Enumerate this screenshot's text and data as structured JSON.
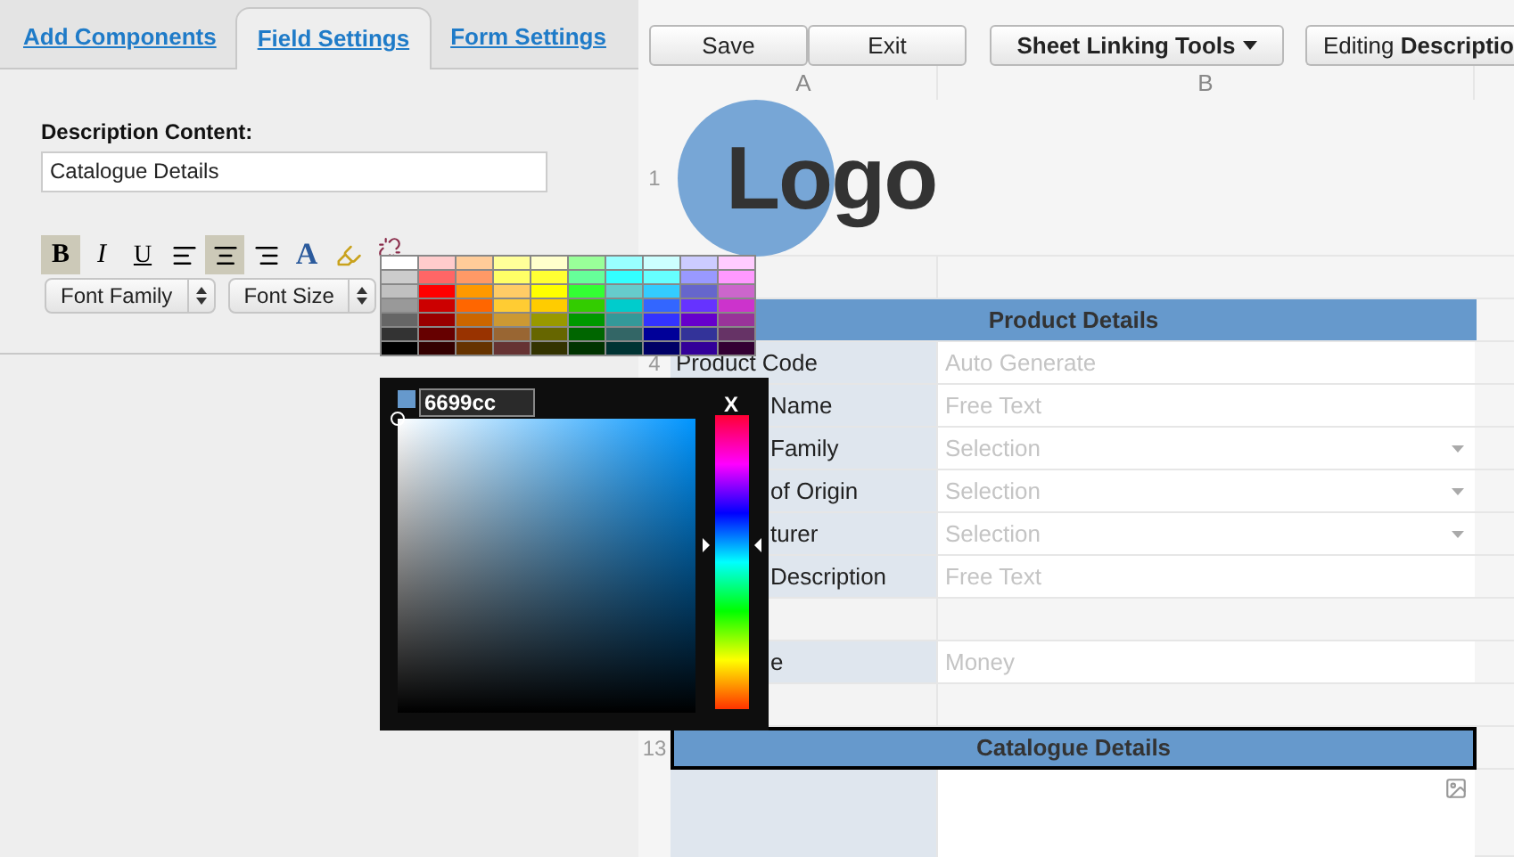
{
  "tabs": [
    {
      "label": "Add Components",
      "selected": false
    },
    {
      "label": "Field Settings",
      "selected": true
    },
    {
      "label": "Form Settings",
      "selected": false
    }
  ],
  "field": {
    "label": "Description Content:",
    "value": "Catalogue Details"
  },
  "format_buttons": [
    {
      "kind": "bold",
      "label": "B",
      "pressed": true
    },
    {
      "kind": "italic",
      "label": "I",
      "pressed": false
    },
    {
      "kind": "underline",
      "label": "U",
      "pressed": false
    },
    {
      "kind": "align-left",
      "pressed": false
    },
    {
      "kind": "align-center",
      "pressed": true
    },
    {
      "kind": "align-right",
      "pressed": false
    },
    {
      "kind": "font-color",
      "label": "A",
      "pressed": false
    },
    {
      "kind": "highlight",
      "pressed": false
    },
    {
      "kind": "unlink",
      "pressed": false
    }
  ],
  "selects": [
    {
      "label": "Font Family"
    },
    {
      "label": "Font Size"
    }
  ],
  "palette": [
    {
      "swatches": [
        {
          "color": "#ffffff"
        },
        {
          "color": "#ffcccc"
        },
        {
          "color": "#ffcc99"
        },
        {
          "color": "#ffff99"
        },
        {
          "color": "#ffffcc"
        },
        {
          "color": "#99ff99"
        },
        {
          "color": "#99ffff"
        },
        {
          "color": "#ccffff"
        },
        {
          "color": "#ccccff"
        },
        {
          "color": "#ffccff"
        }
      ]
    },
    {
      "swatches": [
        {
          "color": "#cccccc"
        },
        {
          "color": "#ff6666"
        },
        {
          "color": "#ff9966"
        },
        {
          "color": "#ffff66"
        },
        {
          "color": "#ffff33"
        },
        {
          "color": "#66ff99"
        },
        {
          "color": "#33ffff"
        },
        {
          "color": "#66ffff"
        },
        {
          "color": "#9999ff"
        },
        {
          "color": "#ff99ff"
        }
      ]
    },
    {
      "swatches": [
        {
          "color": "#c0c0c0"
        },
        {
          "color": "#ff0000"
        },
        {
          "color": "#ff9900"
        },
        {
          "color": "#ffcc66"
        },
        {
          "color": "#ffff00"
        },
        {
          "color": "#33ff33"
        },
        {
          "color": "#66cccc"
        },
        {
          "color": "#33ccff"
        },
        {
          "color": "#6666cc"
        },
        {
          "color": "#cc66cc"
        }
      ]
    },
    {
      "swatches": [
        {
          "color": "#999999"
        },
        {
          "color": "#cc0000"
        },
        {
          "color": "#ff6600"
        },
        {
          "color": "#ffcc33"
        },
        {
          "color": "#ffcc00"
        },
        {
          "color": "#33cc00"
        },
        {
          "color": "#00cccc"
        },
        {
          "color": "#3366ff"
        },
        {
          "color": "#6633ff"
        },
        {
          "color": "#cc33cc"
        }
      ]
    },
    {
      "swatches": [
        {
          "color": "#666666"
        },
        {
          "color": "#990000"
        },
        {
          "color": "#cc6600"
        },
        {
          "color": "#cc9933"
        },
        {
          "color": "#999900"
        },
        {
          "color": "#009900"
        },
        {
          "color": "#339999"
        },
        {
          "color": "#3333ff"
        },
        {
          "color": "#6600cc"
        },
        {
          "color": "#993399"
        }
      ]
    },
    {
      "swatches": [
        {
          "color": "#333333"
        },
        {
          "color": "#660000"
        },
        {
          "color": "#993300"
        },
        {
          "color": "#996633"
        },
        {
          "color": "#666600"
        },
        {
          "color": "#006600"
        },
        {
          "color": "#336666"
        },
        {
          "color": "#000099"
        },
        {
          "color": "#333399"
        },
        {
          "color": "#663366"
        }
      ]
    },
    {
      "swatches": [
        {
          "color": "#000000"
        },
        {
          "color": "#330000"
        },
        {
          "color": "#663300"
        },
        {
          "color": "#663333"
        },
        {
          "color": "#333300"
        },
        {
          "color": "#003300"
        },
        {
          "color": "#003333"
        },
        {
          "color": "#000066"
        },
        {
          "color": "#330099"
        },
        {
          "color": "#330033"
        }
      ]
    }
  ],
  "picker": {
    "color": "#6699cc",
    "value": "6699cc",
    "close": "X",
    "hue_slider": {
      "level": 0.56
    }
  },
  "toolbar": [
    {
      "kind": "plain",
      "label": "Save"
    },
    {
      "kind": "plain",
      "label": "Exit"
    },
    {
      "kind": "menu",
      "label": "Sheet Linking Tools"
    },
    {
      "kind": "rich",
      "label": "Editing **Descriptio**"
    }
  ],
  "columns": [
    "A",
    "B"
  ],
  "rows": [
    {
      "kind": "logo",
      "number": "1",
      "logo": "Logo"
    },
    {
      "kind": "blank"
    },
    {
      "kind": "header",
      "text": "Product Details",
      "selected": false
    },
    {
      "kind": "field",
      "number": "4",
      "label": "Product Code",
      "value": "Auto Generate",
      "dropdown": false
    },
    {
      "kind": "field",
      "label": "Name",
      "value": "Free Text",
      "dropdown": false
    },
    {
      "kind": "field",
      "label": "Family",
      "value": "Selection",
      "dropdown": true
    },
    {
      "kind": "field",
      "label": "of Origin",
      "value": "Selection",
      "dropdown": true
    },
    {
      "kind": "field",
      "label": "turer",
      "value": "Selection",
      "dropdown": true
    },
    {
      "kind": "field",
      "label": "Description",
      "value": "Free Text",
      "dropdown": false
    },
    {
      "kind": "blank"
    },
    {
      "kind": "field",
      "label": "e",
      "value": "Money",
      "dropdown": false
    },
    {
      "kind": "blank"
    },
    {
      "kind": "header",
      "number": "13",
      "text": "Catalogue Details",
      "selected": true
    },
    {
      "kind": "image"
    }
  ]
}
